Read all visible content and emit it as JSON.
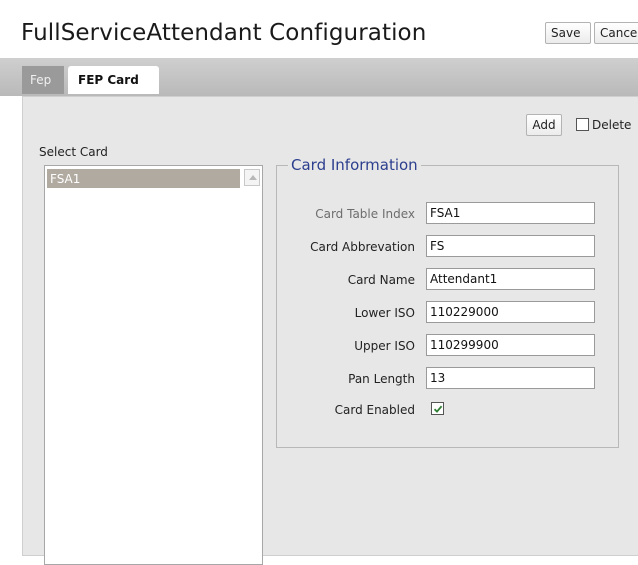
{
  "header": {
    "title": "FullServiceAttendant Configuration",
    "save_label": "Save",
    "cancel_label": "Cance"
  },
  "tabs": [
    {
      "label": "Fep",
      "active": false
    },
    {
      "label": "FEP Card",
      "active": true
    }
  ],
  "toolbar": {
    "add_label": "Add",
    "delete_label": "Delete",
    "delete_checked": false
  },
  "select_card": {
    "label": "Select Card",
    "items": [
      "FSA1"
    ],
    "selected": "FSA1"
  },
  "card_info": {
    "legend": "Card Information",
    "fields": [
      {
        "label": "Card Table Index",
        "value": "FSA1"
      },
      {
        "label": "Card Abbrevation",
        "value": "FS"
      },
      {
        "label": "Card Name",
        "value": "Attendant1"
      },
      {
        "label": "Lower ISO",
        "value": "110229000"
      },
      {
        "label": "Upper ISO",
        "value": "110299900"
      },
      {
        "label": "Pan Length",
        "value": "13"
      }
    ],
    "enabled_label": "Card Enabled",
    "enabled": true
  },
  "colors": {
    "legend": "#2c3e8e",
    "selected_item": "#b0aaa1",
    "checkmark": "#2e7d32"
  }
}
